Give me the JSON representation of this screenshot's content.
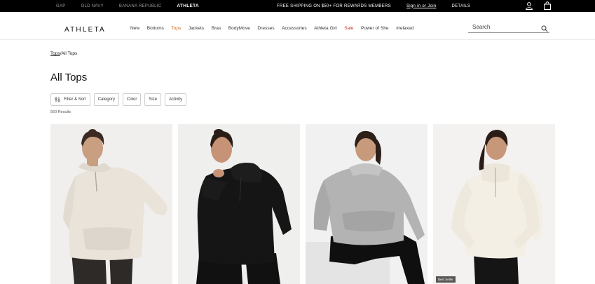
{
  "topbar": {
    "brands": [
      "GAP",
      "OLD NAVY",
      "BANANA REPUBLIC",
      "ATHLETA"
    ],
    "active_brand": "ATHLETA",
    "promo_text": "FREE SHIPPING ON $50+ FOR REWARDS MEMBERS",
    "promo_link": "Sign in or Join",
    "details": "DETAILS",
    "icons": [
      "account-icon",
      "bag-icon"
    ]
  },
  "nav": {
    "logo": "ATHLETA",
    "links": [
      "New",
      "Bottoms",
      "Tops",
      "Jackets",
      "Bras",
      "BodyMove",
      "Dresses",
      "Accessories",
      "Athleta Girl",
      "Sale",
      "Power of She",
      "#relaxed"
    ],
    "highlighted_link": "Tops",
    "sale_link": "Sale",
    "search_placeholder": "Search"
  },
  "breadcrumb": {
    "parent": "Tops",
    "separator": "/",
    "current": "All Tops"
  },
  "page": {
    "title": "All Tops",
    "results": "560 Results"
  },
  "filters": {
    "sort_label": "Filter & Sort",
    "items": [
      "Category",
      "Color",
      "Size",
      "Activity"
    ]
  },
  "products": [
    {
      "name": "Cream hoodie",
      "badge": ""
    },
    {
      "name": "Black hoodie",
      "badge": ""
    },
    {
      "name": "Grey hoodie",
      "badge": ""
    },
    {
      "name": "Ivory half-zip",
      "badge": "Best Seller"
    }
  ],
  "colors": {
    "topbar_bg": "#000000",
    "accent_orange": "#c46a1c",
    "sale_red": "#c0392b"
  }
}
